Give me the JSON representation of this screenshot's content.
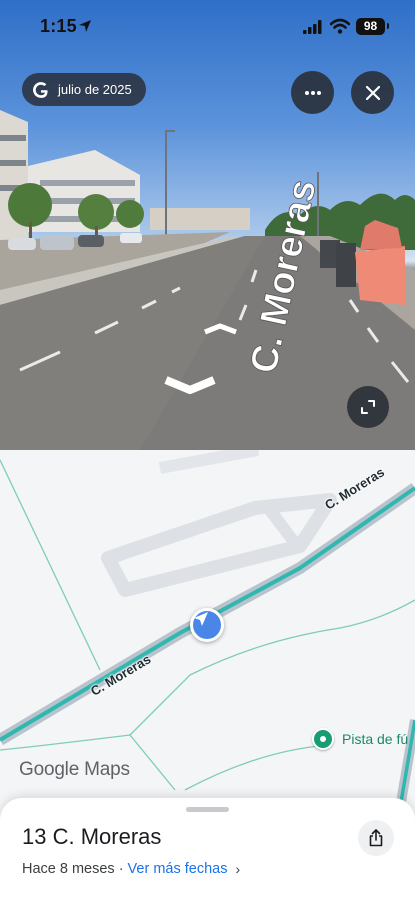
{
  "status_bar": {
    "time": "1:15",
    "battery": "98"
  },
  "street_view": {
    "date_label": "julio de 2025",
    "road_marking": "C. Moreras"
  },
  "map": {
    "road_label": "C. Moreras",
    "poi_name": "Pista de fú",
    "brand_google": "Google",
    "brand_maps": "Maps",
    "accent_color": "#4a86e8",
    "road_color": "#2fb7b0"
  },
  "sheet": {
    "title": "13 C. Moreras",
    "age": "Hace 8 meses",
    "separator": "·",
    "more_dates": "Ver más fechas"
  },
  "icons": [
    "location-arrow-icon",
    "signal-icon",
    "wifi-icon",
    "google-g-icon",
    "more-icon",
    "close-icon",
    "expand-icon",
    "navigation-arrow-icon",
    "poi-pin-icon",
    "share-icon",
    "chevron-right-icon"
  ]
}
